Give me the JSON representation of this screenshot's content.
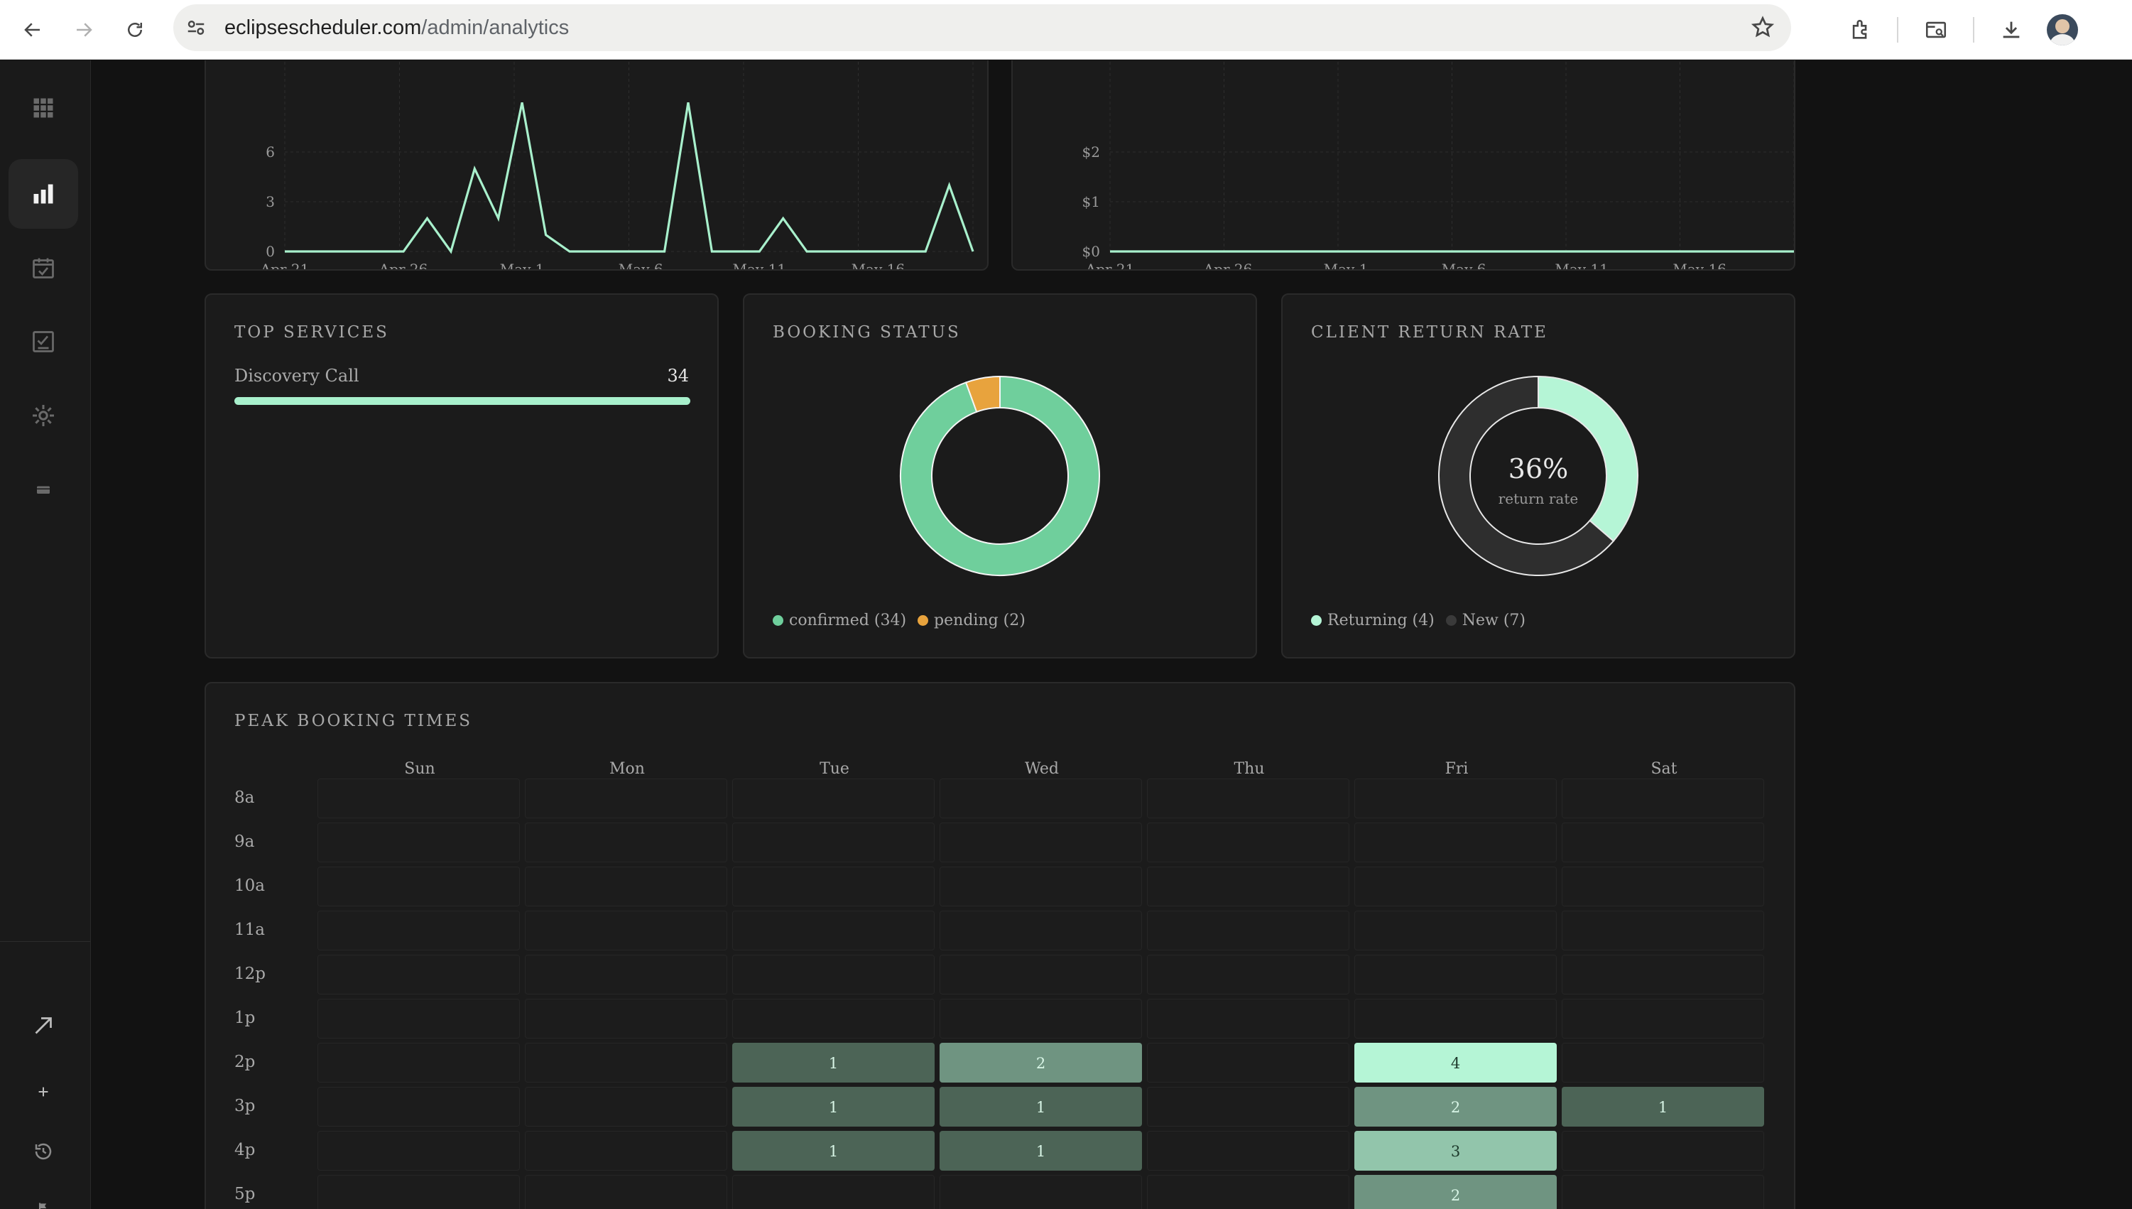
{
  "browser": {
    "url_host": "eclipsescheduler.com",
    "url_path": "/admin/analytics"
  },
  "sidebar": {
    "top_items": [
      {
        "icon": "grid-icon",
        "active": false
      },
      {
        "icon": "bar-chart-icon",
        "active": true
      },
      {
        "icon": "calendar-check-icon",
        "active": false
      },
      {
        "icon": "checklist-icon",
        "active": false
      },
      {
        "icon": "gear-icon",
        "active": false
      },
      {
        "icon": "card-icon",
        "active": false
      }
    ],
    "bottom_items": [
      {
        "icon": "arrow-up-right-icon"
      },
      {
        "icon": "plus-icon"
      },
      {
        "icon": "history-icon"
      },
      {
        "icon": "flag-icon"
      }
    ]
  },
  "bookings_chart": {
    "chart_data": {
      "type": "line",
      "x_tick_labels": [
        "Apr 21",
        "Apr 26",
        "May 1",
        "May 6",
        "May 11",
        "May 16"
      ],
      "y_tick_labels": [
        "0",
        "3",
        "6"
      ],
      "x": [
        "Apr 21",
        "Apr 22",
        "Apr 23",
        "Apr 24",
        "Apr 25",
        "Apr 26",
        "Apr 27",
        "Apr 28",
        "Apr 29",
        "Apr 30",
        "May 1",
        "May 2",
        "May 3",
        "May 4",
        "May 5",
        "May 6",
        "May 7",
        "May 8",
        "May 9",
        "May 10",
        "May 11",
        "May 12",
        "May 13",
        "May 14",
        "May 15",
        "May 16",
        "May 17",
        "May 18",
        "May 19",
        "May 20"
      ],
      "values": [
        0,
        0,
        0,
        0,
        0,
        0,
        2,
        0,
        5,
        2,
        9,
        1,
        0,
        0,
        0,
        0,
        0,
        9,
        0,
        0,
        0,
        2,
        0,
        0,
        0,
        0,
        0,
        0,
        4,
        0
      ],
      "ylim": [
        0,
        9
      ],
      "color": "#a8f0cc",
      "grid": true
    }
  },
  "revenue_chart": {
    "chart_data": {
      "type": "line",
      "x_tick_labels": [
        "Apr 21",
        "Apr 26",
        "May 1",
        "May 6",
        "May 11",
        "May 16"
      ],
      "y_tick_labels": [
        "$0",
        "$1",
        "$2"
      ],
      "values": [
        0,
        0,
        0,
        0,
        0,
        0,
        0,
        0,
        0,
        0,
        0,
        0,
        0,
        0,
        0,
        0,
        0,
        0,
        0,
        0,
        0,
        0,
        0,
        0,
        0,
        0,
        0,
        0,
        0,
        0
      ],
      "ylim": [
        0,
        3
      ],
      "color": "#a8f0cc",
      "grid": true
    }
  },
  "top_services": {
    "title": "TOP SERVICES",
    "items": [
      {
        "name": "Discovery Call",
        "count": "34",
        "fraction": 1.0
      }
    ]
  },
  "booking_status": {
    "title": "BOOKING STATUS",
    "chart_data": {
      "type": "pie",
      "donut": true,
      "slices": [
        {
          "label": "confirmed",
          "value": 34,
          "color": "#6fcf9c"
        },
        {
          "label": "pending",
          "value": 2,
          "color": "#e8a33d"
        }
      ]
    },
    "legend": [
      {
        "text": "confirmed (34)",
        "color": "#6fcf9c"
      },
      {
        "text": "pending (2)",
        "color": "#e8a33d"
      }
    ]
  },
  "client_return": {
    "title": "CLIENT RETURN RATE",
    "center_value": "36%",
    "center_label": "return rate",
    "chart_data": {
      "type": "pie",
      "donut": true,
      "slices": [
        {
          "label": "Returning",
          "value": 4,
          "color": "#b5f5d6"
        },
        {
          "label": "New",
          "value": 7,
          "color": "#2e2e2e"
        }
      ]
    },
    "legend": [
      {
        "text": "Returning (4)",
        "color": "#b5f5d6"
      },
      {
        "text": "New (7)",
        "color": "#3a3a3a"
      }
    ]
  },
  "peak_times": {
    "title": "PEAK BOOKING TIMES",
    "chart_data": {
      "type": "heatmap",
      "days": [
        "Sun",
        "Mon",
        "Tue",
        "Wed",
        "Thu",
        "Fri",
        "Sat"
      ],
      "hours": [
        "8a",
        "9a",
        "10a",
        "11a",
        "12p",
        "1p",
        "2p",
        "3p",
        "4p",
        "5p"
      ],
      "values": [
        [
          0,
          0,
          0,
          0,
          0,
          0,
          0
        ],
        [
          0,
          0,
          0,
          0,
          0,
          0,
          0
        ],
        [
          0,
          0,
          0,
          0,
          0,
          0,
          0
        ],
        [
          0,
          0,
          0,
          0,
          0,
          0,
          0
        ],
        [
          0,
          0,
          0,
          0,
          0,
          0,
          0
        ],
        [
          0,
          0,
          0,
          0,
          0,
          0,
          0
        ],
        [
          0,
          0,
          1,
          2,
          0,
          4,
          0
        ],
        [
          0,
          0,
          1,
          1,
          0,
          2,
          1
        ],
        [
          0,
          0,
          1,
          1,
          0,
          3,
          0
        ],
        [
          0,
          0,
          0,
          0,
          0,
          2,
          0
        ]
      ],
      "max": 4
    }
  }
}
